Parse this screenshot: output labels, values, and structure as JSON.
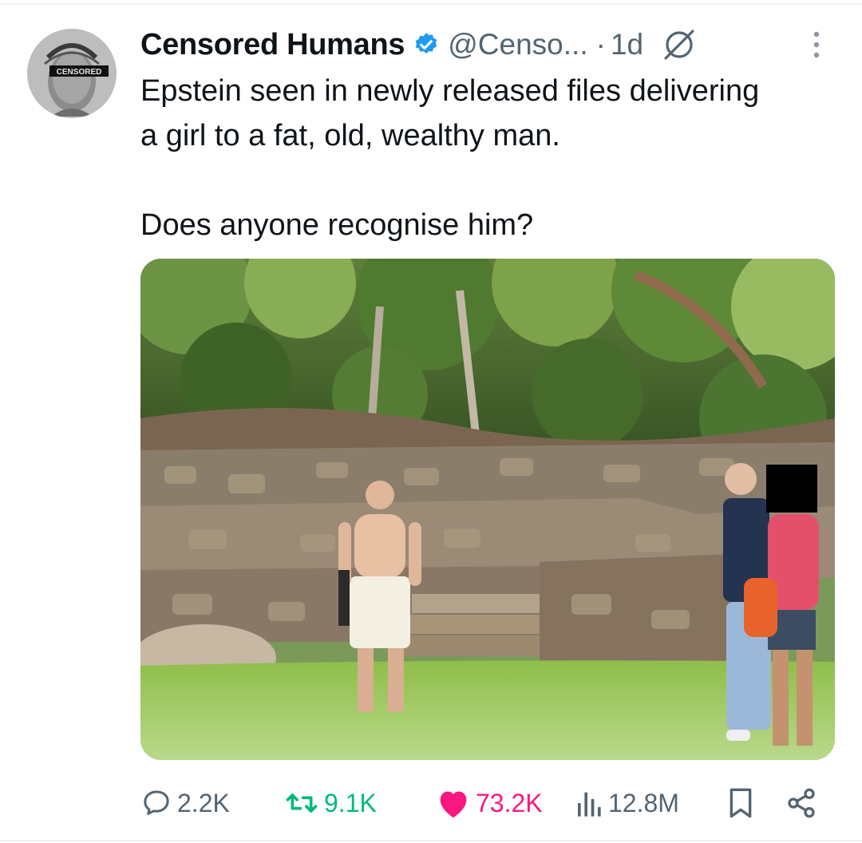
{
  "author": {
    "display_name": "Censored Humans",
    "handle": "@Censo...",
    "separator": "·",
    "time": "1d",
    "avatar_badge": "CENSORED",
    "verified_icon": "verified-badge-icon",
    "grok_icon": "grok-icon",
    "more_icon": "more-vertical-icon",
    "verified_color": "#1d9bf0"
  },
  "tweet": {
    "line1": "Epstein seen in newly released files delivering",
    "line2": "a girl to a fat, old, wealthy man.",
    "line3": "Does anyone recognise him?"
  },
  "media": {
    "type": "photo"
  },
  "actions": {
    "reply": {
      "icon": "reply-icon",
      "count": "2.2K"
    },
    "retweet": {
      "icon": "retweet-icon",
      "count": "9.1K",
      "color": "#00ba7c"
    },
    "like": {
      "icon": "heart-icon",
      "count": "73.2K",
      "color": "#f91880"
    },
    "views": {
      "icon": "views-icon",
      "count": "12.8M"
    },
    "bookmark": {
      "icon": "bookmark-icon"
    },
    "share": {
      "icon": "share-icon"
    }
  }
}
